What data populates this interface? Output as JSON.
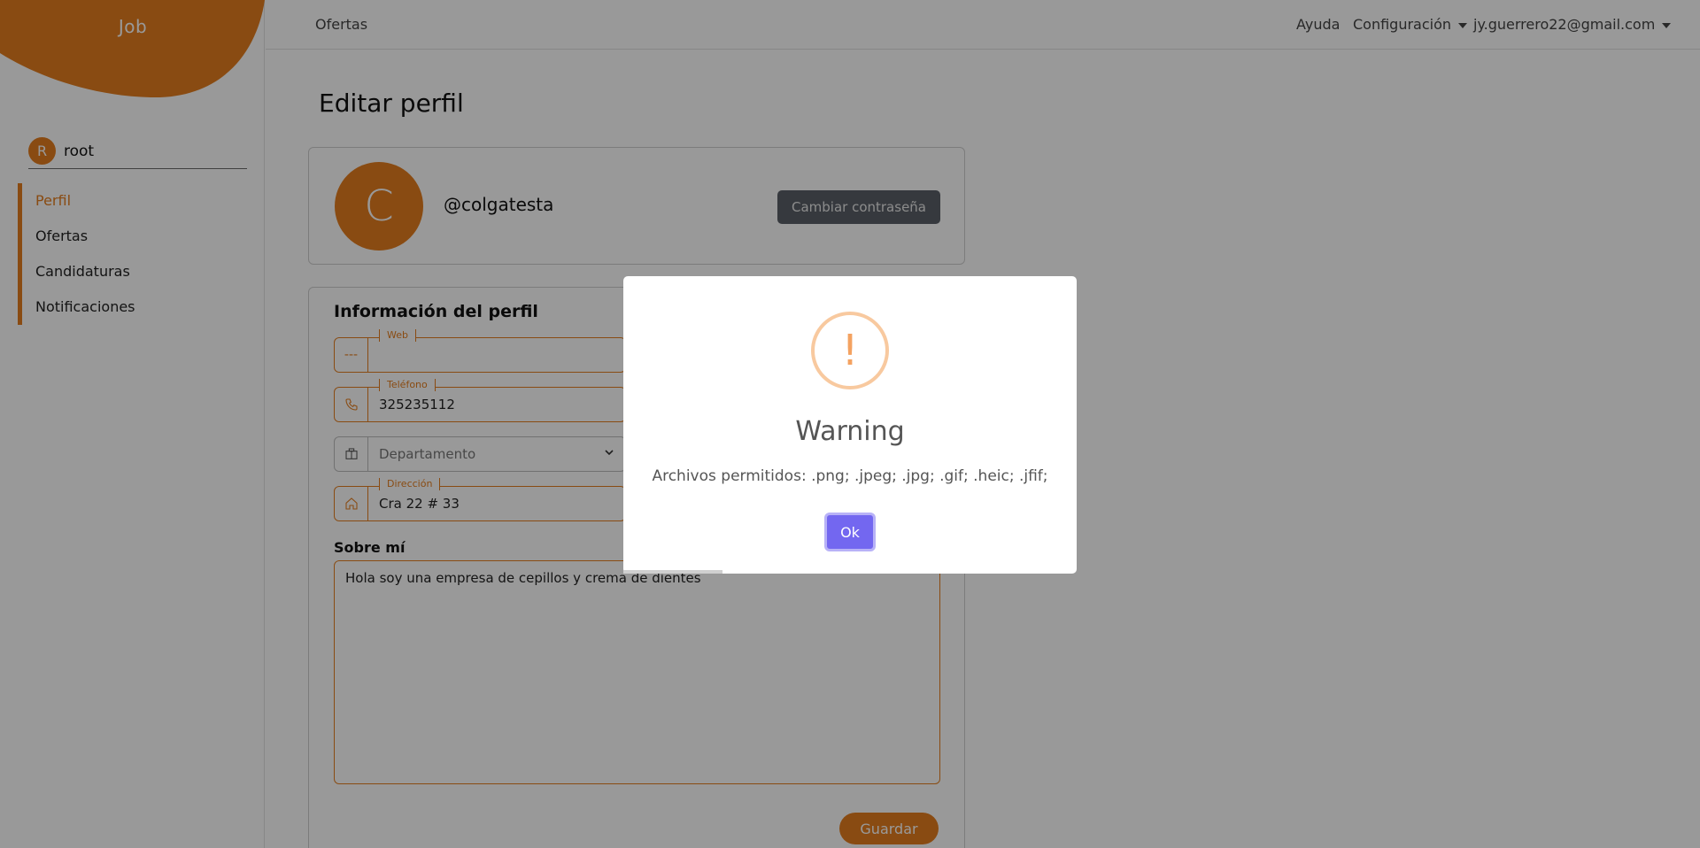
{
  "sidebar": {
    "brand": "Job",
    "user": {
      "initial": "R",
      "name": "root"
    },
    "items": [
      {
        "label": "Perfil",
        "active": true
      },
      {
        "label": "Ofertas",
        "active": false
      },
      {
        "label": "Candidaturas",
        "active": false
      },
      {
        "label": "Notificaciones",
        "active": false
      }
    ]
  },
  "topbar": {
    "left_link": "Ofertas",
    "help": "Ayuda",
    "settings": "Configuración",
    "account": "jy.guerrero22@gmail.com"
  },
  "page": {
    "title": "Editar perfil",
    "profile": {
      "initial": "C",
      "handle": "@colgatesta",
      "change_password": "Cambiar contraseña"
    },
    "info": {
      "title": "Información del perfil",
      "web": {
        "icon": "dash-icon",
        "label": "Web",
        "value": ""
      },
      "phone": {
        "icon": "phone-icon",
        "label": "Teléfono",
        "value": "325235112"
      },
      "department": {
        "icon": "building-icon",
        "placeholder": "Departamento"
      },
      "address": {
        "icon": "home-icon",
        "label": "Dirección",
        "value": "Cra 22 # 33"
      },
      "about_label": "Sobre mí",
      "about_value": "Hola soy una empresa de cepillos y crema de dientes",
      "save": "Guardar"
    }
  },
  "modal": {
    "icon": "warning-icon",
    "icon_glyph": "!",
    "title": "Warning",
    "message": "Archivos permitidos: .png; .jpeg; .jpg; .gif; .heic; .jfif;",
    "ok": "Ok"
  },
  "colors": {
    "accent": "#e57e1e",
    "confirm": "#7367f0"
  }
}
